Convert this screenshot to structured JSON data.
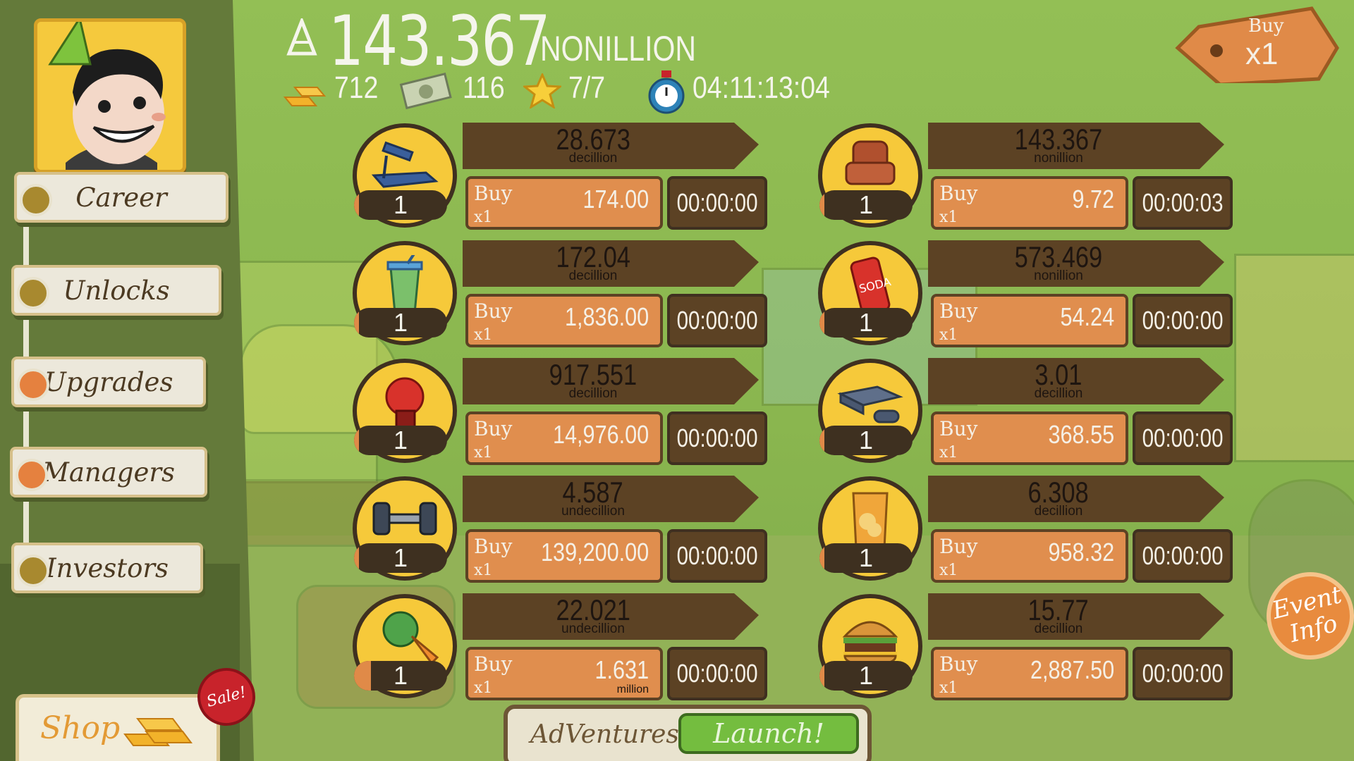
{
  "top": {
    "cash_value": "143.367",
    "cash_unit": "NONILLION",
    "gold": "712",
    "megabucks": "116",
    "stars": "7/7",
    "event_timer": "04:11:13:04"
  },
  "buy_multiplier": {
    "label": "Buy",
    "value": "x1"
  },
  "nav": [
    "Career",
    "Unlocks",
    "Upgrades",
    "Managers",
    "Investors"
  ],
  "shop": {
    "label": "Shop",
    "badge": "Sale!"
  },
  "adventures": {
    "label": "AdVentures",
    "launch_label": "Launch!"
  },
  "event_info": {
    "line1": "Event",
    "line2": "Info"
  },
  "buy_label": "Buy",
  "businesses": [
    {
      "icon": "treadmill-icon",
      "level": "1",
      "progress": 0.05,
      "profit": "28.673",
      "profit_unit": "decillion",
      "buy_qty": "x1",
      "cost": "174.00",
      "cost_unit": "",
      "timer": "00:00:00"
    },
    {
      "icon": "recliner-icon",
      "level": "1",
      "progress": 0.05,
      "profit": "143.367",
      "profit_unit": "nonillion",
      "buy_qty": "x1",
      "cost": "9.72",
      "cost_unit": "",
      "timer": "00:00:03"
    },
    {
      "icon": "smoothie-icon",
      "level": "1",
      "progress": 0.05,
      "profit": "172.04",
      "profit_unit": "decillion",
      "buy_qty": "x1",
      "cost": "1,836.00",
      "cost_unit": "",
      "timer": "00:00:00"
    },
    {
      "icon": "soda-can-icon",
      "level": "1",
      "progress": 0.05,
      "profit": "573.469",
      "profit_unit": "nonillion",
      "buy_qty": "x1",
      "cost": "54.24",
      "cost_unit": "",
      "timer": "00:00:00"
    },
    {
      "icon": "boxing-glove-icon",
      "level": "1",
      "progress": 0.05,
      "profit": "917.551",
      "profit_unit": "decillion",
      "buy_qty": "x1",
      "cost": "14,976.00",
      "cost_unit": "",
      "timer": "00:00:00"
    },
    {
      "icon": "game-console-icon",
      "level": "1",
      "progress": 0.05,
      "profit": "3.01",
      "profit_unit": "decillion",
      "buy_qty": "x1",
      "cost": "368.55",
      "cost_unit": "",
      "timer": "00:00:00"
    },
    {
      "icon": "dumbbell-icon",
      "level": "1",
      "progress": 0.05,
      "profit": "4.587",
      "profit_unit": "undecillion",
      "buy_qty": "x1",
      "cost": "139,200.00",
      "cost_unit": "",
      "timer": "00:00:00"
    },
    {
      "icon": "chips-bag-icon",
      "level": "1",
      "progress": 0.05,
      "profit": "6.308",
      "profit_unit": "decillion",
      "buy_qty": "x1",
      "cost": "958.32",
      "cost_unit": "",
      "timer": "00:00:00"
    },
    {
      "icon": "vegetables-icon",
      "level": "1",
      "progress": 0.18,
      "profit": "22.021",
      "profit_unit": "undecillion",
      "buy_qty": "x1",
      "cost": "1.631",
      "cost_unit": "million",
      "timer": "00:00:00"
    },
    {
      "icon": "burger-icon",
      "level": "1",
      "progress": 0.05,
      "profit": "15.77",
      "profit_unit": "decillion",
      "buy_qty": "x1",
      "cost": "2,887.50",
      "cost_unit": "",
      "timer": "00:00:00"
    }
  ],
  "colors": {
    "background": "#8db552",
    "tile_dark": "#5c4224",
    "buy_orange": "#e08e4e",
    "circle_yellow": "#f6c93a",
    "launch_green": "#74bd3f",
    "text_light": "#f5f5ec"
  }
}
